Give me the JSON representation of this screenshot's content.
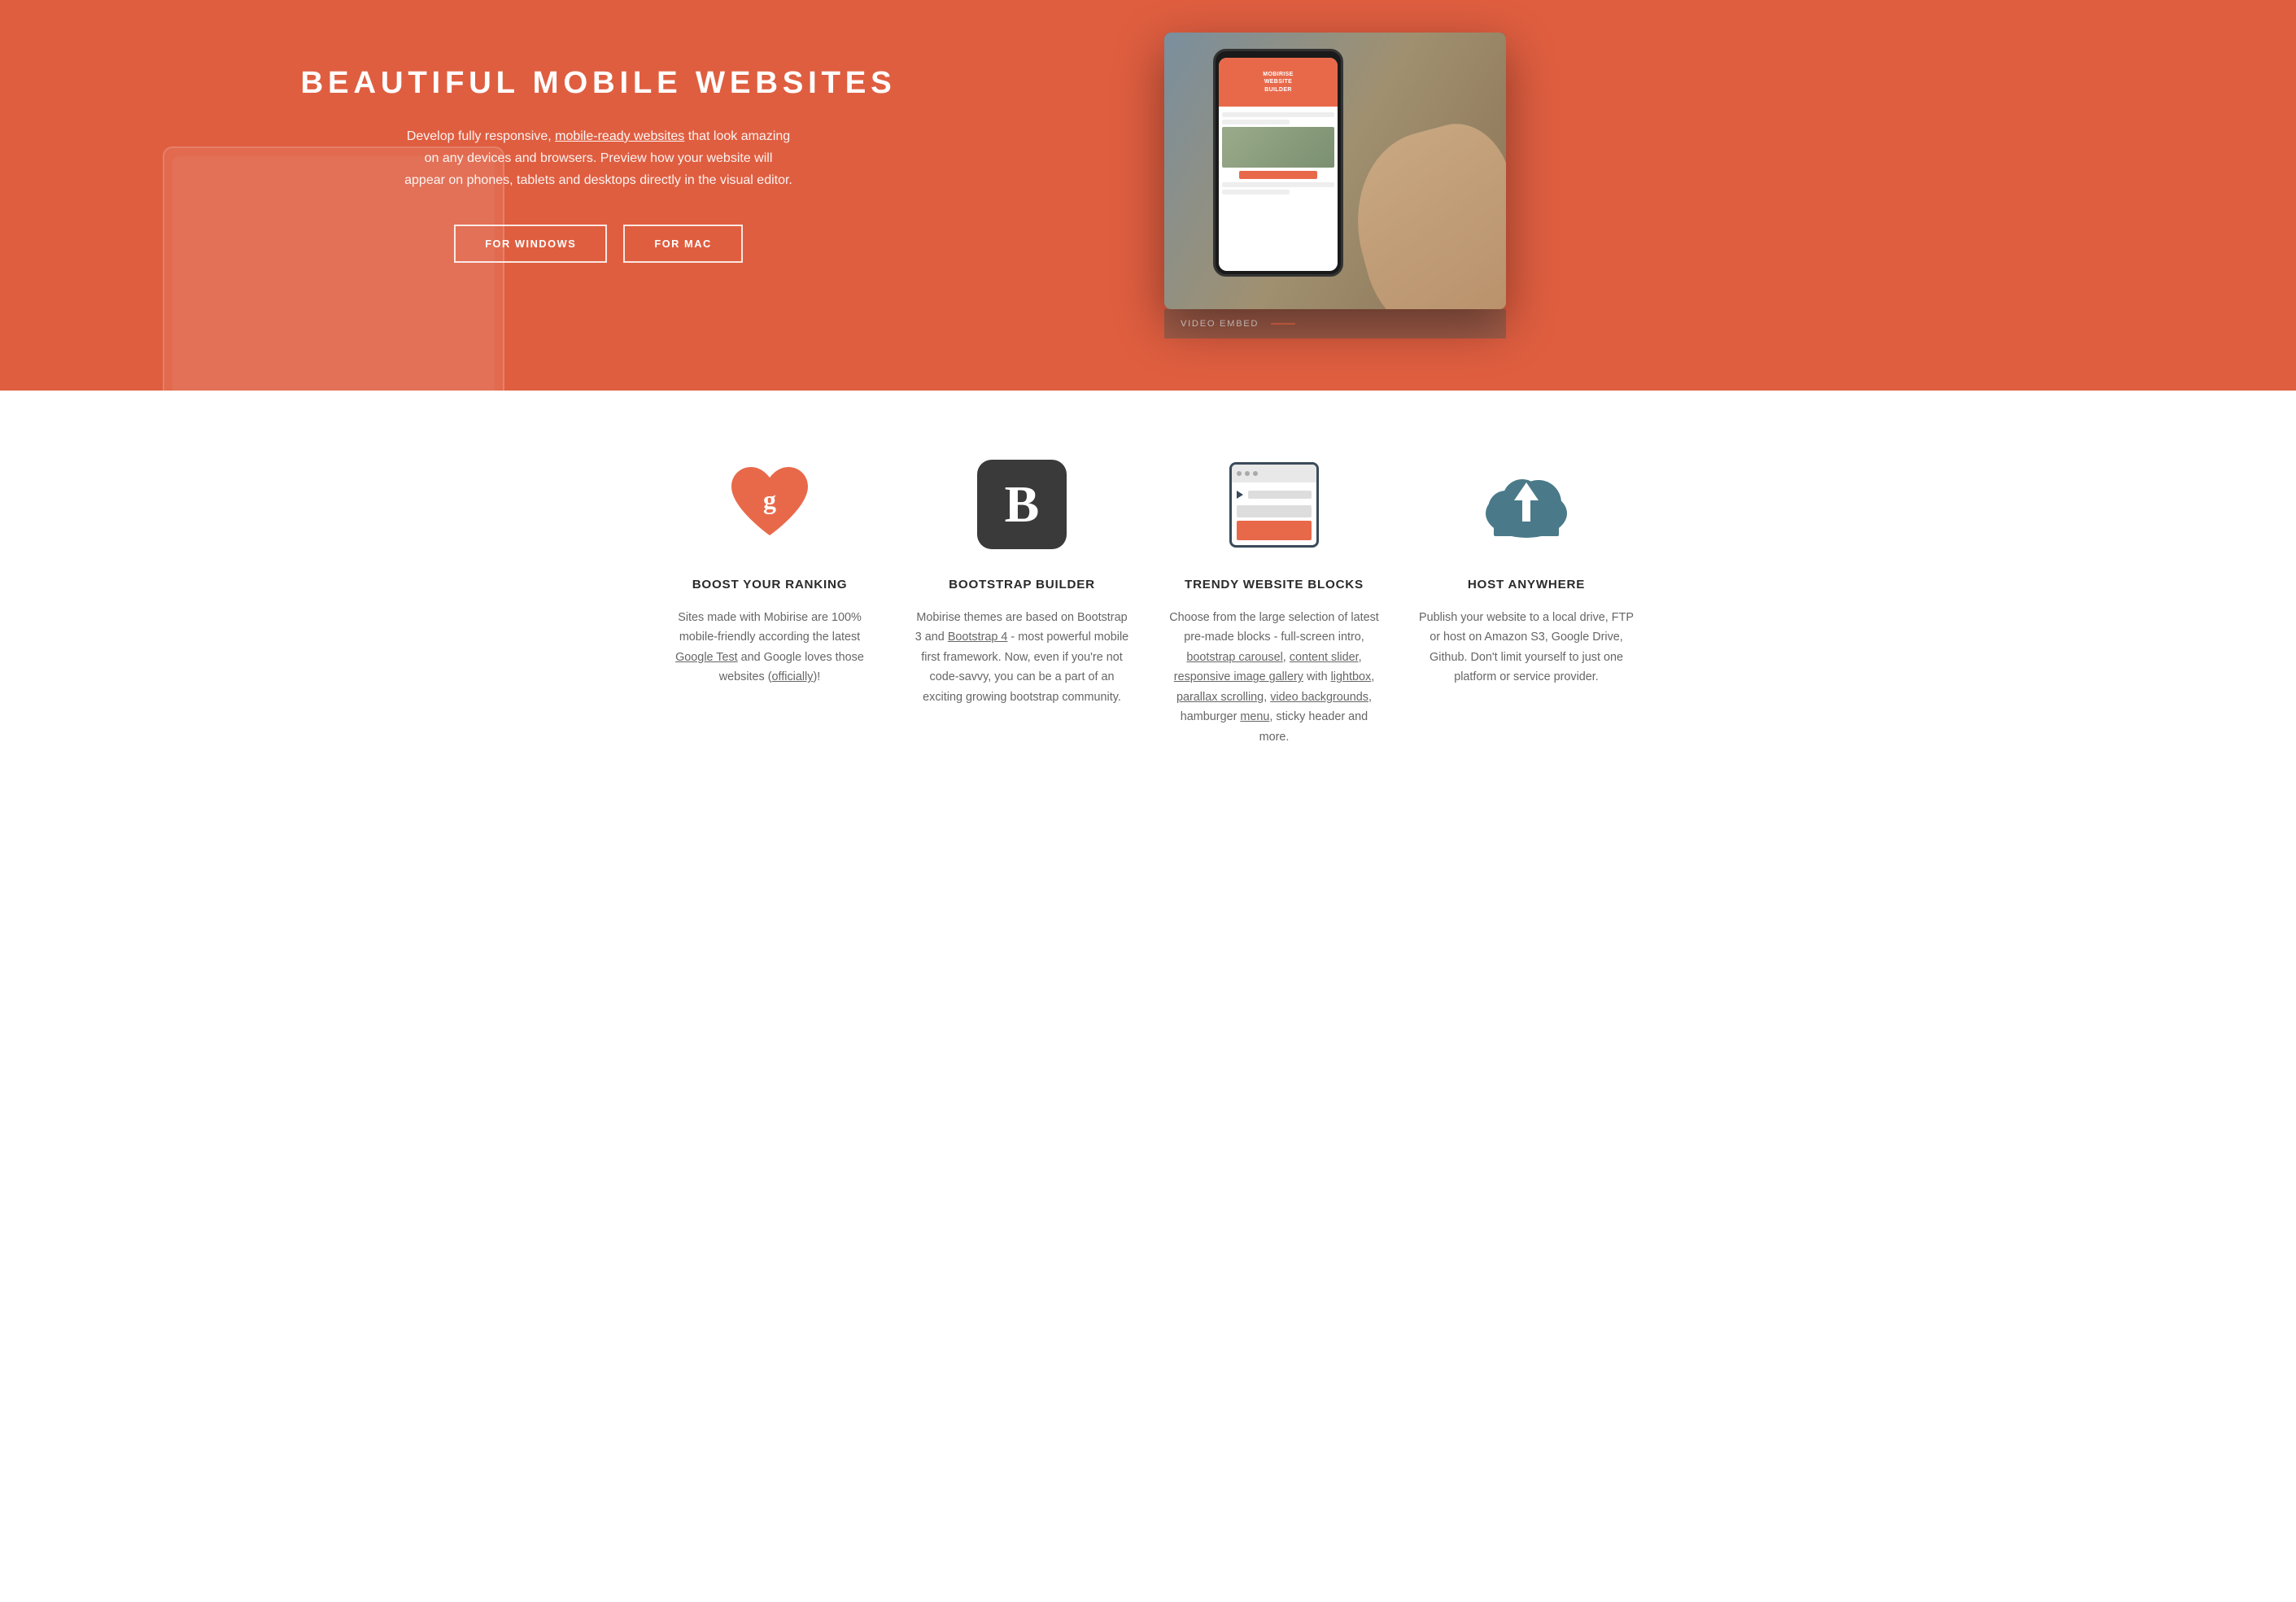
{
  "hero": {
    "title": "BEAUTIFUL MOBILE WEBSITES",
    "description_part1": "Develop fully responsive, ",
    "description_link": "mobile-ready websites",
    "description_part2": " that look amazing on any devices and browsers. Preview how your website will appear on phones, tablets and desktops directly in the visual editor.",
    "btn_windows": "FOR WINDOWS",
    "btn_mac": "FOR MAC",
    "phone_header_line1": "MOBIRISE",
    "phone_header_line2": "WEBSITE",
    "phone_header_line3": "BUILDER",
    "video_label": "VIDEO EMBED"
  },
  "features": [
    {
      "id": "boost",
      "icon": "heart-google",
      "title": "BOOST YOUR RANKING",
      "desc_parts": [
        {
          "type": "text",
          "content": "Sites made with Mobirise are 100% mobile-friendly according the latest "
        },
        {
          "type": "link",
          "content": "Google Test"
        },
        {
          "type": "text",
          "content": " and Google loves those websites ("
        },
        {
          "type": "link",
          "content": "officially"
        },
        {
          "type": "text",
          "content": ")!"
        }
      ]
    },
    {
      "id": "bootstrap",
      "icon": "bootstrap-b",
      "title": "BOOTSTRAP BUILDER",
      "desc_parts": [
        {
          "type": "text",
          "content": "Mobirise themes are based on Bootstrap 3 and "
        },
        {
          "type": "link",
          "content": "Bootstrap 4"
        },
        {
          "type": "text",
          "content": " - most powerful mobile first framework. Now, even if you're not code-savvy, you can be a part of an exciting growing bootstrap community."
        }
      ]
    },
    {
      "id": "trendy",
      "icon": "browser-window",
      "title": "TRENDY WEBSITE BLOCKS",
      "desc_parts": [
        {
          "type": "text",
          "content": "Choose from the large selection of latest pre-made blocks - full-screen intro, "
        },
        {
          "type": "link",
          "content": "bootstrap carousel"
        },
        {
          "type": "text",
          "content": ", "
        },
        {
          "type": "link",
          "content": "content slider"
        },
        {
          "type": "text",
          "content": ", "
        },
        {
          "type": "link",
          "content": "responsive image gallery"
        },
        {
          "type": "text",
          "content": " with "
        },
        {
          "type": "link",
          "content": "lightbox"
        },
        {
          "type": "text",
          "content": ", "
        },
        {
          "type": "link",
          "content": "parallax scrolling"
        },
        {
          "type": "text",
          "content": ", "
        },
        {
          "type": "link",
          "content": "video backgrounds"
        },
        {
          "type": "text",
          "content": ", hamburger "
        },
        {
          "type": "link",
          "content": "menu"
        },
        {
          "type": "text",
          "content": ", sticky header and more."
        }
      ]
    },
    {
      "id": "host",
      "icon": "cloud-upload",
      "title": "HOST ANYWHERE",
      "desc": "Publish your website to a local drive, FTP or host on Amazon S3, Google Drive, Github. Don't limit yourself to just one platform or service provider."
    }
  ],
  "colors": {
    "accent": "#e8694a",
    "dark": "#3a3a3a",
    "text": "#666666",
    "cloud_bg": "#4a7a8a"
  }
}
